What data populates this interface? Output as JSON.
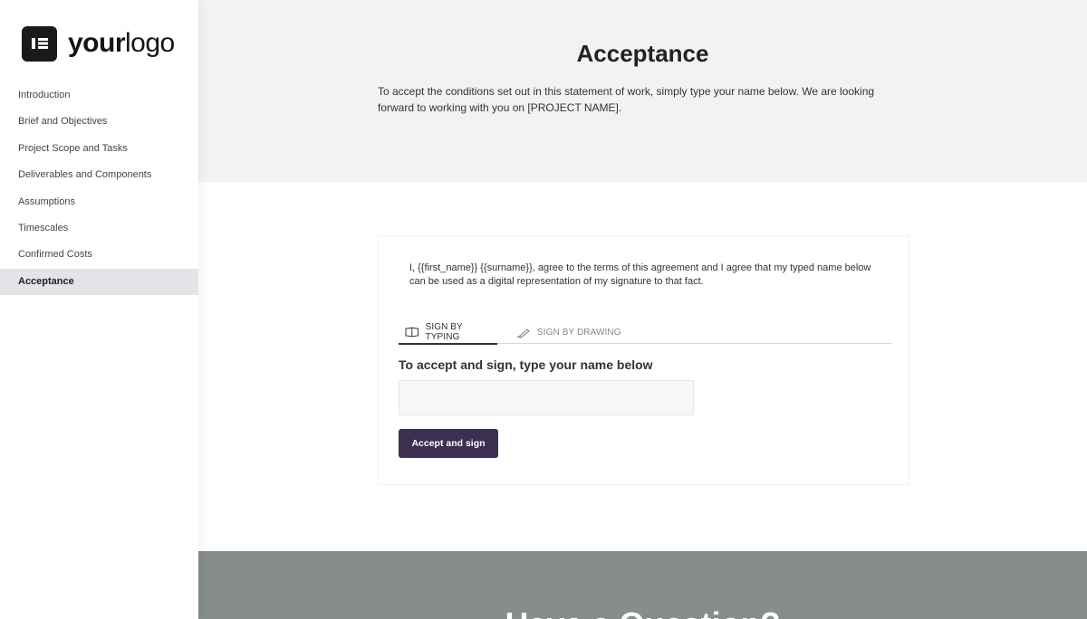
{
  "logo": {
    "text_strong": "your",
    "text_light": "logo",
    "icon": "document-logo-icon"
  },
  "sidebar": {
    "items": [
      {
        "label": "Introduction",
        "active": false
      },
      {
        "label": "Brief and Objectives",
        "active": false
      },
      {
        "label": "Project Scope and Tasks",
        "active": false
      },
      {
        "label": "Deliverables and Components",
        "active": false
      },
      {
        "label": "Assumptions",
        "active": false
      },
      {
        "label": "Timescales",
        "active": false
      },
      {
        "label": "Confirmed Costs",
        "active": false
      },
      {
        "label": "Acceptance",
        "active": true
      }
    ]
  },
  "hero": {
    "title": "Acceptance",
    "description": "To accept the conditions set out in this statement of work, simply type your name below.  We are looking forward to working with you on [PROJECT NAME]."
  },
  "signature": {
    "agreement_text": "I, {{first_name}} {{surname}}, agree to the terms of this agreement and I agree that my typed name below can be used as a digital representation of my signature to that fact.",
    "tabs": [
      {
        "label": "SIGN BY TYPING",
        "icon": "keyboard-icon",
        "active": true
      },
      {
        "label": "SIGN BY DRAWING",
        "icon": "pen-icon",
        "active": false
      }
    ],
    "heading": "To accept and sign, type your name below",
    "name_value": "",
    "button_label": "Accept and sign"
  },
  "footer": {
    "title": "Have a Question?"
  },
  "colors": {
    "accent": "#3d2f51",
    "hero_bg": "#f2f2f2",
    "footer_bg": "#868d8b",
    "active_nav_bg": "#e3e4e8"
  }
}
